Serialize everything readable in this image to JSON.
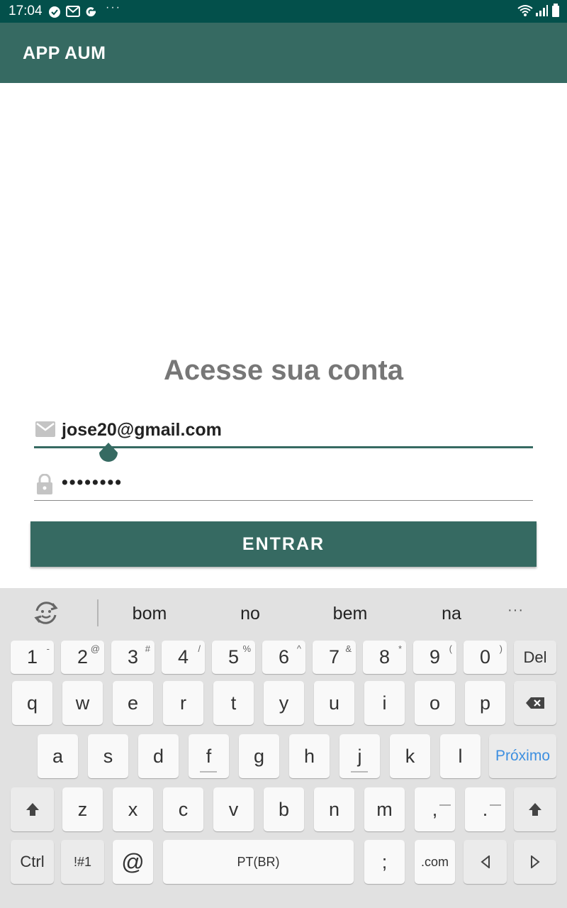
{
  "status_bar": {
    "time": "17:04",
    "more": "···"
  },
  "app_bar": {
    "title": "APP AUM"
  },
  "login": {
    "heading": "Acesse sua conta",
    "email_value": "jose20@gmail.com",
    "password_value": "••••••••",
    "submit_label": "ENTRAR"
  },
  "theme": {
    "primary": "#366a62",
    "status_bar": "#03504b",
    "heading": "#777777",
    "keyboard_bg": "#e1e1e1",
    "accent_blue": "#3d8fe0"
  },
  "keyboard": {
    "suggestions": [
      "bom",
      "no",
      "bem",
      "na"
    ],
    "more": "···",
    "row_numbers": [
      {
        "label": "1",
        "sup": "-"
      },
      {
        "label": "2",
        "sup": "@"
      },
      {
        "label": "3",
        "sup": "#"
      },
      {
        "label": "4",
        "sup": "/"
      },
      {
        "label": "5",
        "sup": "%"
      },
      {
        "label": "6",
        "sup": "^"
      },
      {
        "label": "7",
        "sup": "&"
      },
      {
        "label": "8",
        "sup": "*"
      },
      {
        "label": "9",
        "sup": "("
      },
      {
        "label": "0",
        "sup": ")"
      }
    ],
    "del": "Del",
    "row1": [
      "q",
      "w",
      "e",
      "r",
      "t",
      "y",
      "u",
      "i",
      "o",
      "p"
    ],
    "row2": [
      "a",
      "s",
      "d",
      "f",
      "g",
      "h",
      "j",
      "k",
      "l"
    ],
    "next": "Próximo",
    "row3": [
      "z",
      "x",
      "c",
      "v",
      "b",
      "n",
      "m",
      ",",
      "."
    ],
    "row3_sup": [
      "",
      "",
      "",
      "",
      "",
      "",
      "",
      "—",
      "—"
    ],
    "ctrl": "Ctrl",
    "symbols": "!#1",
    "at": "@",
    "space": "PT(BR)",
    "semicolon": ";",
    "dotcom": ".com"
  }
}
